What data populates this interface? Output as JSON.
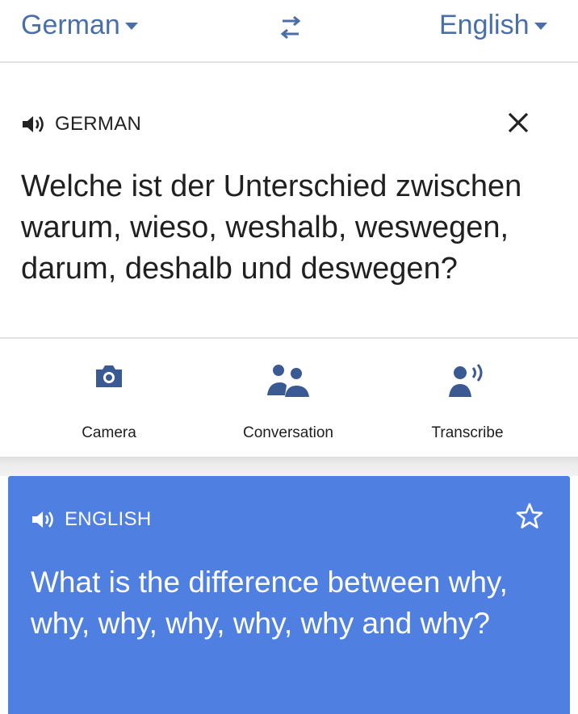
{
  "language_bar": {
    "source_language": "German",
    "target_language": "English",
    "swap_icon": "swap-arrows-icon"
  },
  "source": {
    "label": "GERMAN",
    "text": "Welche ist der Unterschied zwischen warum, wieso, weshalb, weswegen, darum, deshalb und deswegen?",
    "speaker_icon": "speaker-icon",
    "close_icon": "close-icon"
  },
  "tools": [
    {
      "label": "Camera",
      "icon": "camera-icon"
    },
    {
      "label": "Conversation",
      "icon": "conversation-icon"
    },
    {
      "label": "Transcribe",
      "icon": "transcribe-icon"
    }
  ],
  "translation": {
    "label": "ENGLISH",
    "text": "What is the difference between why, why, why, why, why, why and why?",
    "speaker_icon": "speaker-icon",
    "star_icon": "star-icon"
  },
  "colors": {
    "accent": "#4a6fa8",
    "translation_card": "#4f7fe0",
    "icon_blue": "#3b5a94"
  }
}
